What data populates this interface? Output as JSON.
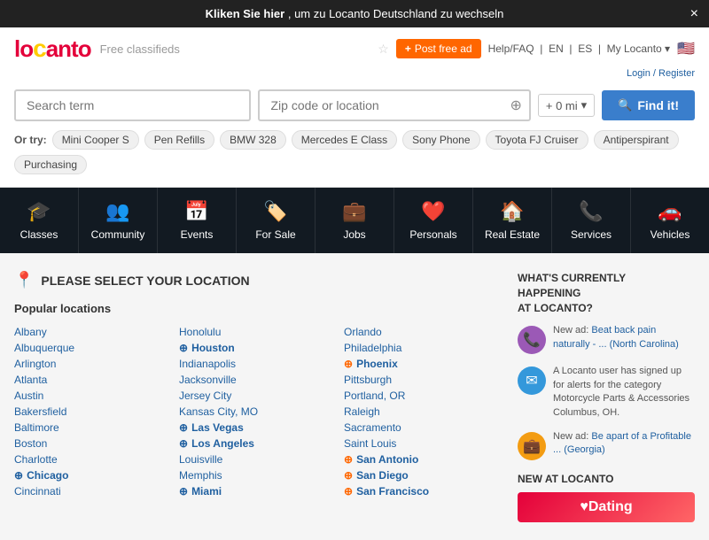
{
  "banner": {
    "text_prefix": "Kliken Sie hier",
    "text_suffix": ", um zu Locanto Deutschland zu wechseln",
    "close_label": "×"
  },
  "header": {
    "logo_text": "locanto",
    "tagline": "Free classifieds",
    "star_label": "★",
    "post_btn": "Post free ad",
    "help_text": "Help/FAQ",
    "lang_en": "EN",
    "lang_es": "ES",
    "my_locanto": "My Locanto",
    "flag": "🇺🇸",
    "login_register": "Login / Register"
  },
  "search": {
    "term_placeholder": "Search term",
    "location_placeholder": "Zip code or location",
    "distance_label": "+ 0 mi",
    "find_btn": "Find it!",
    "or_try_label": "Or try:",
    "pills": [
      "Mini Cooper S",
      "Pen Refills",
      "BMW 328",
      "Mercedes E Class",
      "Sony Phone",
      "Toyota FJ Cruiser",
      "Antiperspirant",
      "Purchasing"
    ]
  },
  "categories": [
    {
      "id": "classes",
      "label": "Classes",
      "icon": "🎓"
    },
    {
      "id": "community",
      "label": "Community",
      "icon": "👥"
    },
    {
      "id": "events",
      "label": "Events",
      "icon": "📅"
    },
    {
      "id": "for-sale",
      "label": "For Sale",
      "icon": "🏷️"
    },
    {
      "id": "jobs",
      "label": "Jobs",
      "icon": "💼"
    },
    {
      "id": "personals",
      "label": "Personals",
      "icon": "❤️"
    },
    {
      "id": "real-estate",
      "label": "Real Estate",
      "icon": "🏠"
    },
    {
      "id": "services",
      "label": "Services",
      "icon": "📞"
    },
    {
      "id": "vehicles",
      "label": "Vehicles",
      "icon": "🚗"
    }
  ],
  "location_section": {
    "title": "PLEASE SELECT YOUR LOCATION",
    "popular_title": "Popular locations"
  },
  "locations": {
    "col1": [
      {
        "name": "Albany",
        "bold": false,
        "icon": ""
      },
      {
        "name": "Albuquerque",
        "bold": false,
        "icon": ""
      },
      {
        "name": "Arlington",
        "bold": false,
        "icon": ""
      },
      {
        "name": "Atlanta",
        "bold": false,
        "icon": ""
      },
      {
        "name": "Austin",
        "bold": false,
        "icon": ""
      },
      {
        "name": "Bakersfield",
        "bold": false,
        "icon": ""
      },
      {
        "name": "Baltimore",
        "bold": false,
        "icon": ""
      },
      {
        "name": "Boston",
        "bold": false,
        "icon": ""
      },
      {
        "name": "Charlotte",
        "bold": false,
        "icon": ""
      },
      {
        "name": "Chicago",
        "bold": true,
        "icon": "star"
      },
      {
        "name": "Cincinnati",
        "bold": false,
        "icon": ""
      }
    ],
    "col2": [
      {
        "name": "Honolulu",
        "bold": false,
        "icon": ""
      },
      {
        "name": "Houston",
        "bold": true,
        "icon": "star"
      },
      {
        "name": "Indianapolis",
        "bold": false,
        "icon": ""
      },
      {
        "name": "Jacksonville",
        "bold": false,
        "icon": ""
      },
      {
        "name": "Jersey City",
        "bold": false,
        "icon": ""
      },
      {
        "name": "Kansas City, MO",
        "bold": false,
        "icon": ""
      },
      {
        "name": "Las Vegas",
        "bold": true,
        "icon": "star"
      },
      {
        "name": "Los Angeles",
        "bold": true,
        "icon": "star"
      },
      {
        "name": "Louisville",
        "bold": false,
        "icon": ""
      },
      {
        "name": "Memphis",
        "bold": false,
        "icon": ""
      },
      {
        "name": "Miami",
        "bold": true,
        "icon": "star"
      }
    ],
    "col3": [
      {
        "name": "Orlando",
        "bold": false,
        "icon": ""
      },
      {
        "name": "Philadelphia",
        "bold": false,
        "icon": ""
      },
      {
        "name": "Phoenix",
        "bold": true,
        "icon": "orange"
      },
      {
        "name": "Pittsburgh",
        "bold": false,
        "icon": ""
      },
      {
        "name": "Portland, OR",
        "bold": false,
        "icon": ""
      },
      {
        "name": "Raleigh",
        "bold": false,
        "icon": ""
      },
      {
        "name": "Sacramento",
        "bold": false,
        "icon": ""
      },
      {
        "name": "Saint Louis",
        "bold": false,
        "icon": ""
      },
      {
        "name": "San Antonio",
        "bold": true,
        "icon": "orange"
      },
      {
        "name": "San Diego",
        "bold": true,
        "icon": "orange"
      },
      {
        "name": "San Francisco",
        "bold": true,
        "icon": "orange"
      }
    ]
  },
  "happening": {
    "title": "WHAT'S CURRENTLY\nHAPPENING\nAT LOCANTO?",
    "items": [
      {
        "icon_type": "purple",
        "icon": "📞",
        "text": "New ad: Beat back pain naturally - ... (North Carolina)"
      },
      {
        "icon_type": "blue",
        "icon": "✉",
        "text": "A Locanto user has signed up for alerts for the category Motorcycle Parts & Accessories Columbus, OH."
      },
      {
        "icon_type": "yellow",
        "icon": "💼",
        "text": "New ad: Be apart of a Profitable ... (Georgia)"
      }
    ]
  },
  "new_at_locanto": {
    "title": "NEW AT LOCANTO",
    "dating_label": "♥Dating"
  }
}
